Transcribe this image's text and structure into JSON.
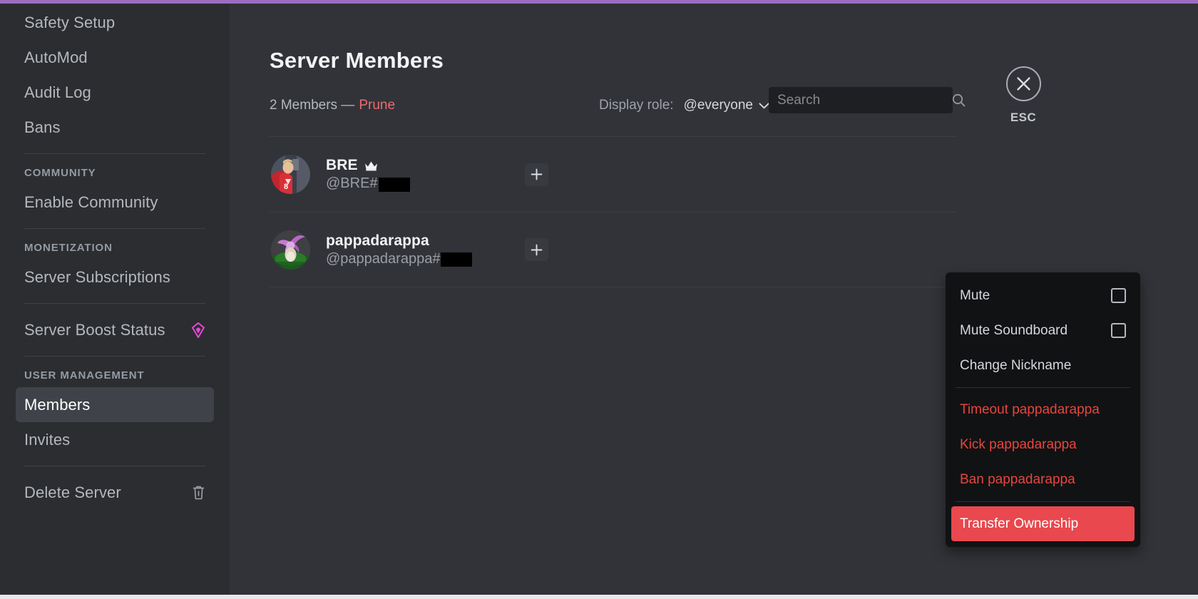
{
  "theme": {
    "accent_top_border": "#9b6dbf",
    "sidebar_bg": "#2b2d31",
    "main_bg": "#313338",
    "menu_bg": "#111214",
    "danger_red": "#e8453c",
    "selected_red": "#e8484e",
    "prune_red": "#ed6b6e",
    "boost_pink": "#ff4fd8"
  },
  "sidebar": {
    "items": [
      {
        "label": "Safety Setup",
        "active": false,
        "icon": null
      },
      {
        "label": "AutoMod",
        "active": false,
        "icon": null
      },
      {
        "label": "Audit Log",
        "active": false,
        "icon": null
      },
      {
        "label": "Bans",
        "active": false,
        "icon": null
      }
    ],
    "community_header": "COMMUNITY",
    "community_items": [
      {
        "label": "Enable Community",
        "active": false,
        "icon": null
      }
    ],
    "monetization_header": "MONETIZATION",
    "monetization_items": [
      {
        "label": "Server Subscriptions",
        "active": false,
        "icon": null
      }
    ],
    "boost_item": {
      "label": "Server Boost Status",
      "icon": "boost-gem-icon"
    },
    "user_management_header": "USER MANAGEMENT",
    "user_management_items": [
      {
        "label": "Members",
        "active": true,
        "icon": null
      },
      {
        "label": "Invites",
        "active": false,
        "icon": null
      }
    ],
    "delete_item": {
      "label": "Delete Server",
      "icon": "trash-icon"
    }
  },
  "main": {
    "title": "Server Members",
    "member_count_text": "2 Members —",
    "prune_label": "Prune",
    "display_role_label": "Display role:",
    "selected_role": "@everyone",
    "role_chevron_icon": "chevron-down-icon",
    "search": {
      "placeholder": "Search",
      "value": "",
      "icon": "search-icon"
    },
    "members": [
      {
        "name": "BRE",
        "owner": true,
        "owner_icon": "crown-icon",
        "handle_prefix": "@BRE#",
        "discriminator_redacted": true,
        "add_role_icon": "plus-icon",
        "avatar_name": "avatar-bre"
      },
      {
        "name": "pappadarappa",
        "owner": false,
        "owner_icon": null,
        "handle_prefix": "@pappadarappa#",
        "discriminator_redacted": true,
        "add_role_icon": "plus-icon",
        "avatar_name": "avatar-pappadarappa"
      }
    ]
  },
  "close": {
    "icon": "close-x-icon",
    "label": "ESC"
  },
  "context_menu": {
    "groups": [
      {
        "items": [
          {
            "label": "Mute",
            "type": "checkbox",
            "checked": false,
            "danger": false,
            "selected": false
          },
          {
            "label": "Mute Soundboard",
            "type": "checkbox",
            "checked": false,
            "danger": false,
            "selected": false
          },
          {
            "label": "Change Nickname",
            "type": "action",
            "checked": null,
            "danger": false,
            "selected": false
          }
        ]
      },
      {
        "items": [
          {
            "label": "Timeout pappadarappa",
            "type": "action",
            "checked": null,
            "danger": true,
            "selected": false
          },
          {
            "label": "Kick pappadarappa",
            "type": "action",
            "checked": null,
            "danger": true,
            "selected": false
          },
          {
            "label": "Ban pappadarappa",
            "type": "action",
            "checked": null,
            "danger": true,
            "selected": false
          }
        ]
      },
      {
        "items": [
          {
            "label": "Transfer Ownership",
            "type": "action",
            "checked": null,
            "danger": true,
            "selected": true
          }
        ]
      }
    ]
  }
}
